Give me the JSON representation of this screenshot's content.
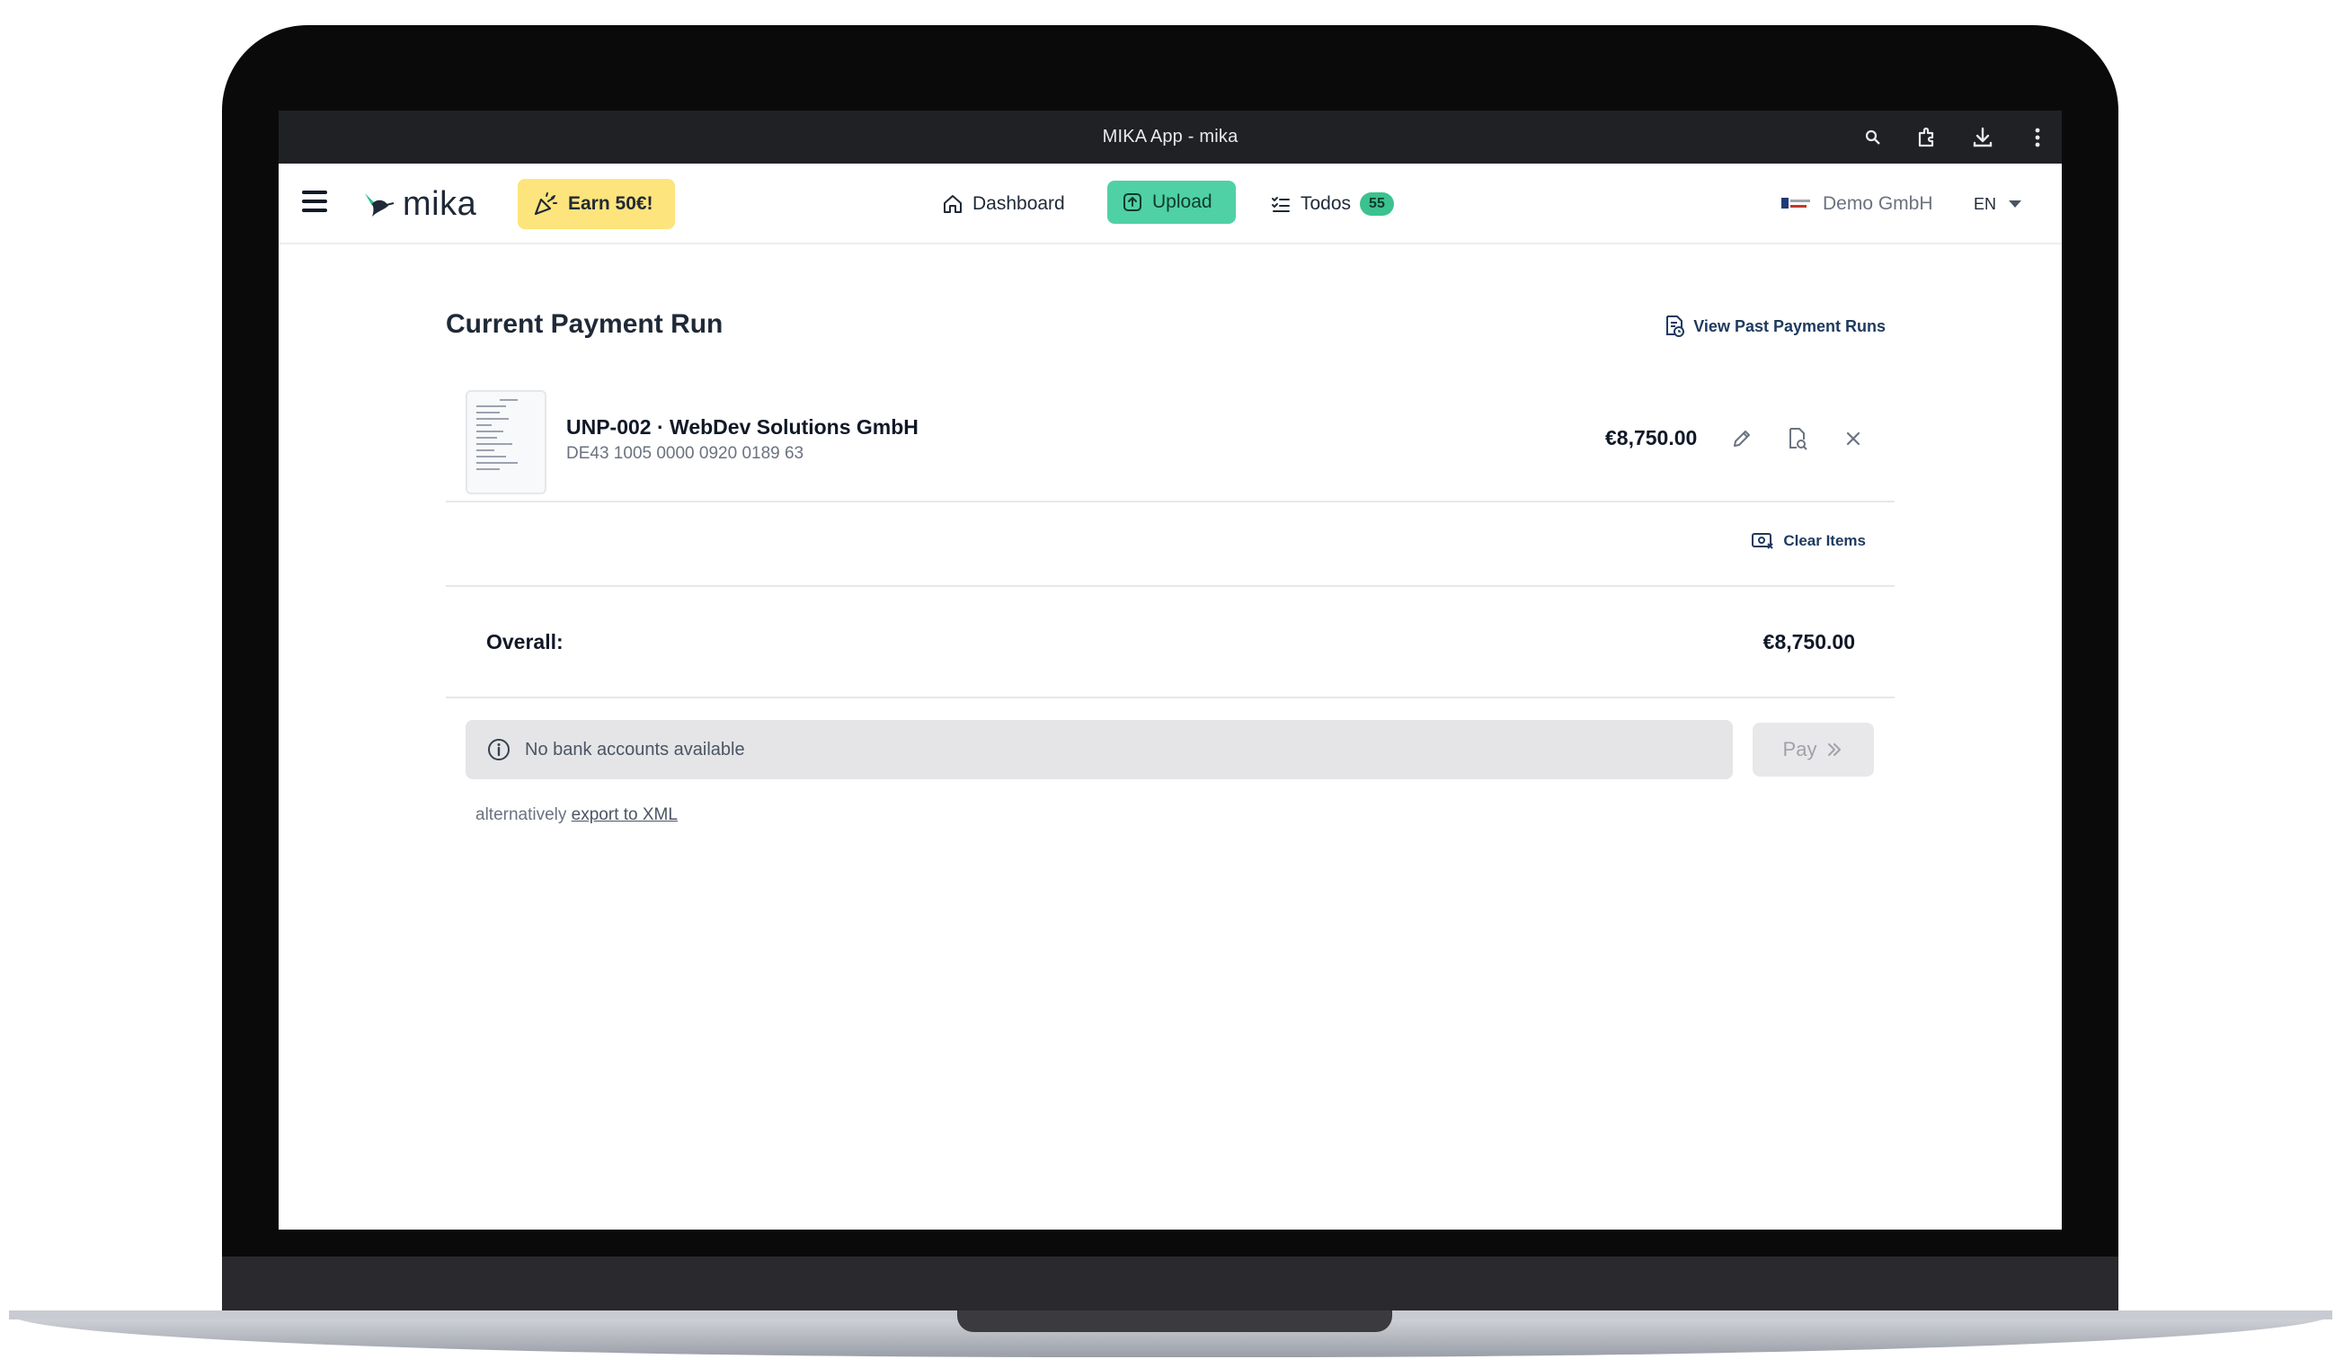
{
  "browser": {
    "window_title": "MIKA App - mika"
  },
  "appbar": {
    "logo_text": "mika",
    "earn_label": "Earn 50€!",
    "nav": {
      "dashboard": "Dashboard",
      "upload": "Upload",
      "todos": "Todos",
      "todos_count": "55"
    },
    "company_name": "Demo GmbH",
    "language": "EN"
  },
  "page": {
    "title": "Current Payment Run",
    "past_runs_label": "View Past Payment Runs",
    "items": [
      {
        "title": "UNP-002 · WebDev Solutions GmbH",
        "iban": "DE43 1005 0000 0920 0189 63",
        "amount": "€8,750.00"
      }
    ],
    "clear_items_label": "Clear Items",
    "overall_label": "Overall:",
    "overall_value": "€8,750.00",
    "bank_notice": "No bank accounts available",
    "pay_label": "Pay",
    "alternative_prefix": "alternatively",
    "export_link": "export to XML"
  },
  "colors": {
    "accent": "#4fd1a5",
    "earn_bg": "#fde47c",
    "titlebar_bg": "#202124",
    "link": "#1e3a5f"
  }
}
